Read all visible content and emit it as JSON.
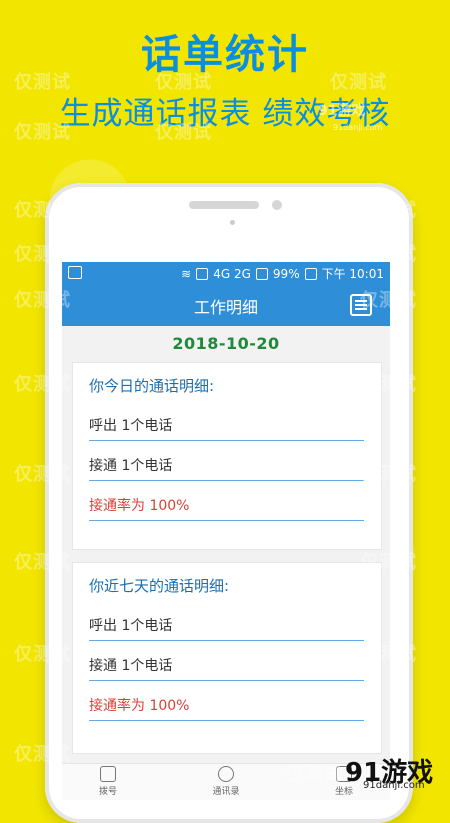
{
  "banner": {
    "title": "话单统计",
    "subtitle": "生成通话报表  绩效考核"
  },
  "watermarks": {
    "text": "仅测试",
    "badge": "91游戏",
    "badge_url": "91danji.com"
  },
  "status_bar": {
    "signal_text": "4G 2G",
    "battery": "99%",
    "time": "下午 10:01"
  },
  "toolbar": {
    "title": "工作明细",
    "calendar_icon": "calendar-icon"
  },
  "date": "2018-10-20",
  "today_card": {
    "title": "你今日的通话明细:",
    "outgoing": "呼出 1个电话",
    "connected": "接通 1个电话",
    "rate": "接通率为 100%"
  },
  "week_card": {
    "title": "你近七天的通话明细:",
    "outgoing": "呼出 1个电话",
    "connected": "接通 1个电话",
    "rate": "接通率为 100%"
  },
  "bottom_nav": [
    {
      "label": "拨号",
      "icon": "dialpad-icon"
    },
    {
      "label": "通讯录",
      "icon": "contacts-icon"
    },
    {
      "label": "坐标",
      "icon": "location-icon"
    }
  ],
  "brand_logo": {
    "text": "91游戏",
    "url": "91danji.com"
  },
  "colors": {
    "background": "#f2e600",
    "accent_blue": "#2e8fd8",
    "date_green": "#1f8a3a",
    "rate_red": "#d9413a"
  }
}
